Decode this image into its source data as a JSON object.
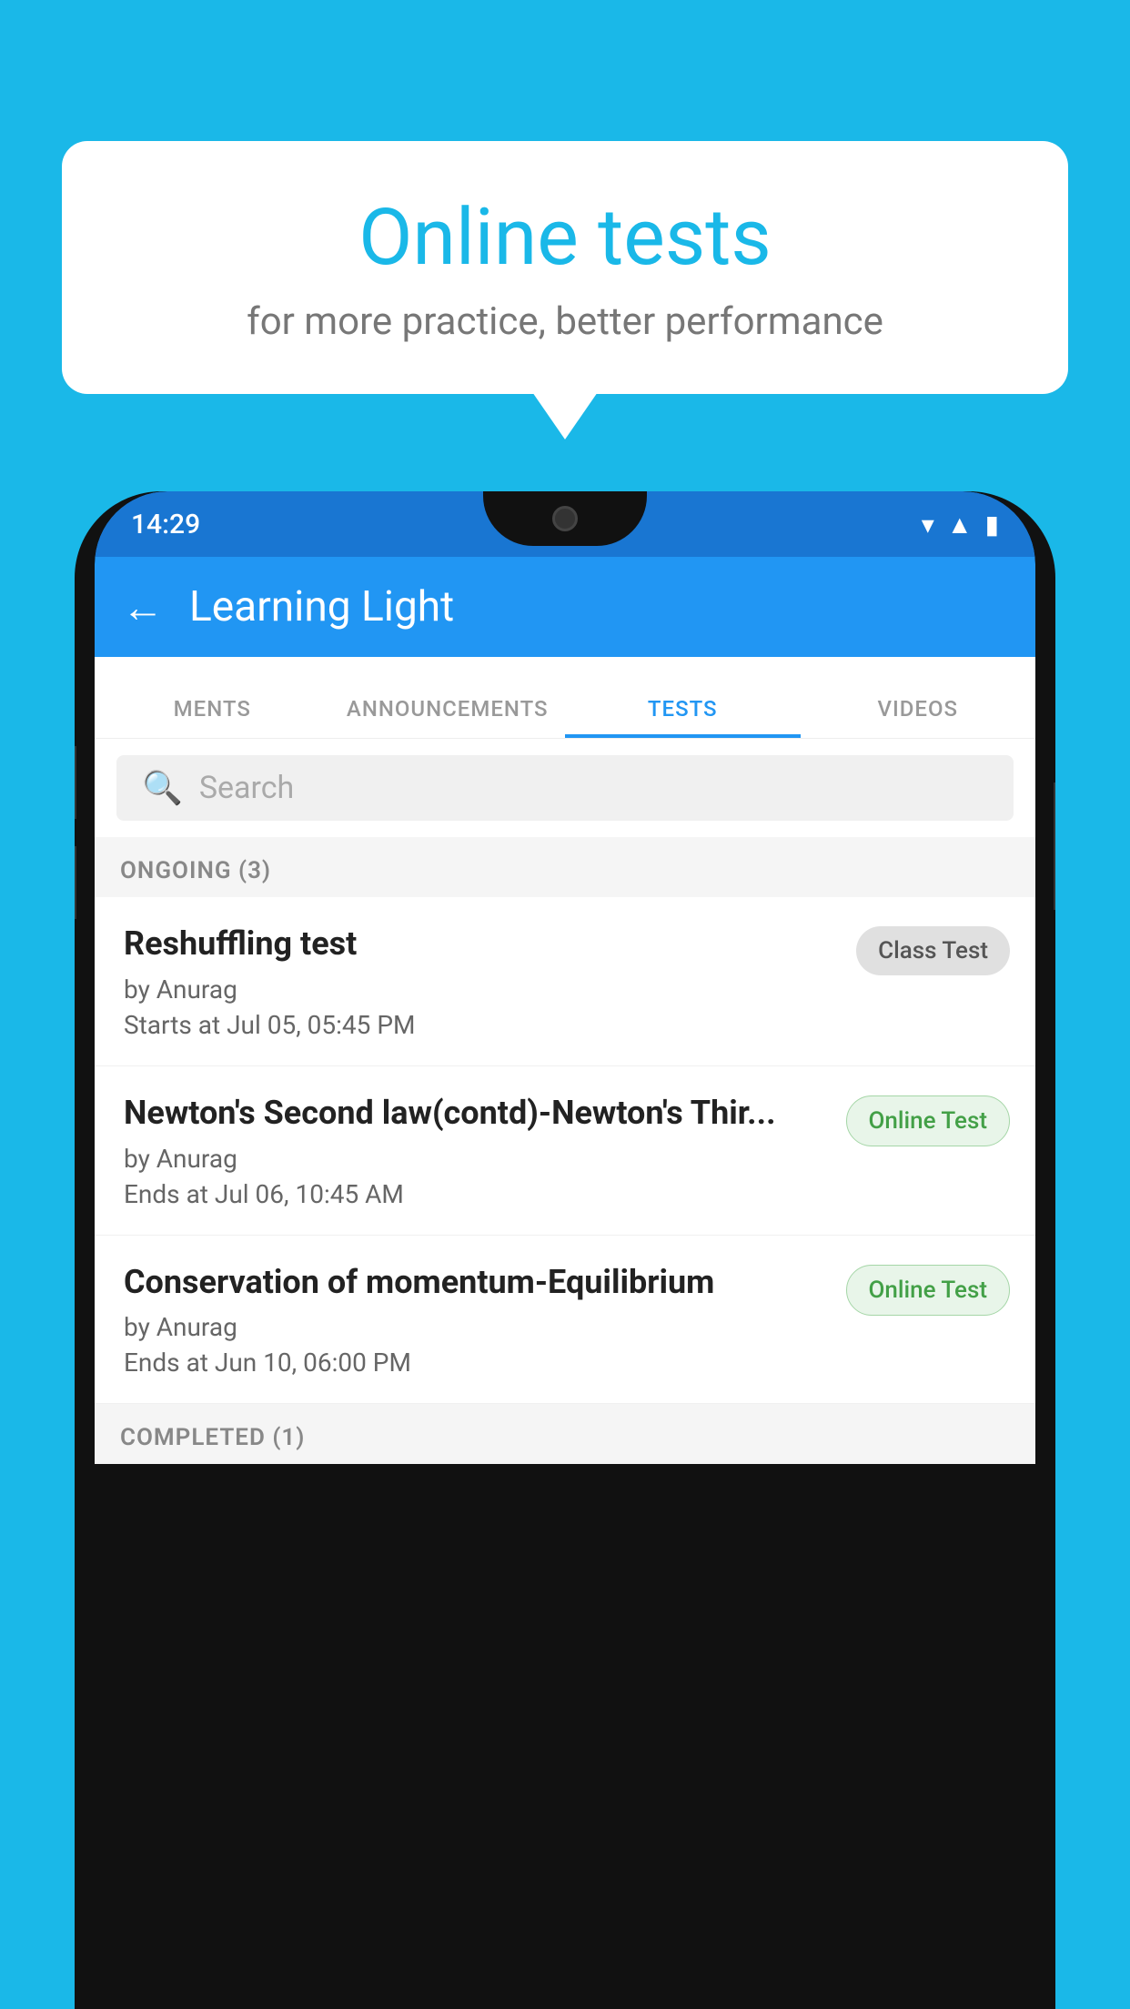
{
  "background": {
    "color": "#1ab8e8"
  },
  "speech_bubble": {
    "title": "Online tests",
    "subtitle": "for more practice, better performance"
  },
  "phone": {
    "status_bar": {
      "time": "14:29",
      "icons": [
        "wifi",
        "signal",
        "battery"
      ]
    },
    "app_bar": {
      "back_label": "←",
      "title": "Learning Light"
    },
    "tabs": [
      {
        "label": "MENTS",
        "active": false
      },
      {
        "label": "ANNOUNCEMENTS",
        "active": false
      },
      {
        "label": "TESTS",
        "active": true
      },
      {
        "label": "VIDEOS",
        "active": false
      }
    ],
    "search": {
      "placeholder": "Search"
    },
    "sections": [
      {
        "header": "ONGOING (3)",
        "items": [
          {
            "title": "Reshuffling test",
            "author": "by Anurag",
            "date": "Starts at  Jul 05, 05:45 PM",
            "badge": "Class Test",
            "badge_type": "class"
          },
          {
            "title": "Newton's Second law(contd)-Newton's Thir...",
            "author": "by Anurag",
            "date": "Ends at  Jul 06, 10:45 AM",
            "badge": "Online Test",
            "badge_type": "online"
          },
          {
            "title": "Conservation of momentum-Equilibrium",
            "author": "by Anurag",
            "date": "Ends at  Jun 10, 06:00 PM",
            "badge": "Online Test",
            "badge_type": "online"
          }
        ]
      },
      {
        "header": "COMPLETED (1)",
        "items": []
      }
    ]
  }
}
